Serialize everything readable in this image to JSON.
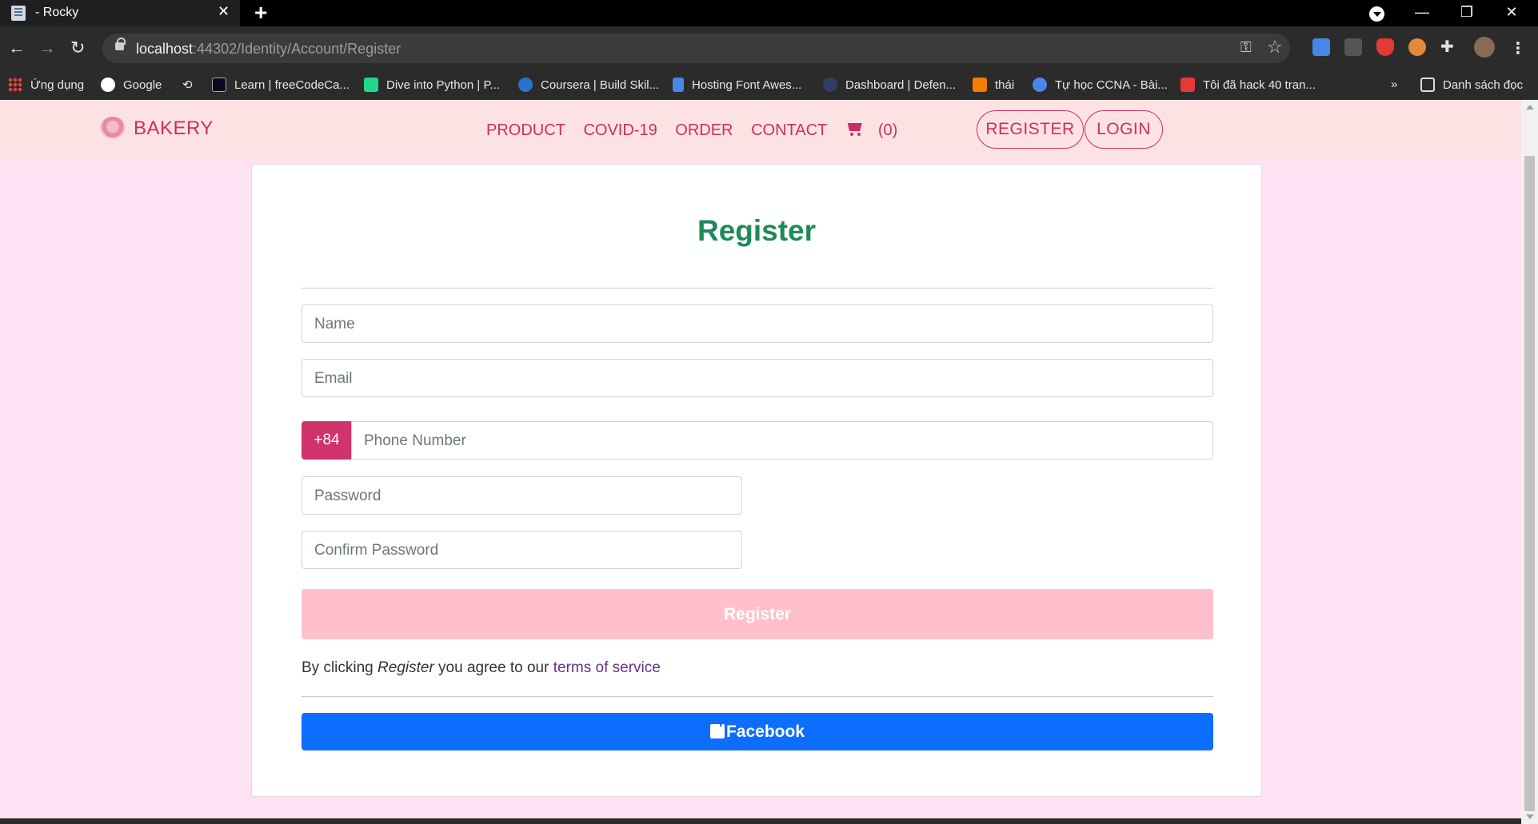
{
  "browser": {
    "tab_title": "- Rocky",
    "url_host": "localhost",
    "url_path": ":44302/Identity/Account/Register",
    "bookmarks": [
      {
        "label": "Ứng dụng",
        "icon": "apps-grid-icon",
        "color": "#e94235"
      },
      {
        "label": "Google",
        "icon": "google-icon",
        "color": "#ffffff"
      },
      {
        "label": "",
        "icon": "history-icon",
        "color": "#cccccc"
      },
      {
        "label": "Learn | freeCodeCa...",
        "icon": "freecodecamp-icon",
        "color": "#0a0a23"
      },
      {
        "label": "Dive into Python | P...",
        "icon": "pycharm-icon",
        "color": "#21d789"
      },
      {
        "label": "Coursera | Build Skil...",
        "icon": "coursera-icon",
        "color": "#2a73cc"
      },
      {
        "label": "Hosting Font Awes...",
        "icon": "flag-icon",
        "color": "#4a86e8"
      },
      {
        "label": "Dashboard | Defen...",
        "icon": "dashboard-icon",
        "color": "#2f3e63"
      },
      {
        "label": "thái",
        "icon": "blogger-icon",
        "color": "#f57d00"
      },
      {
        "label": "Tự học CCNA - Bài...",
        "icon": "search-globe-icon",
        "color": "#4a86e8"
      },
      {
        "label": "Tôi đã hack 40 tran...",
        "icon": "t-icon",
        "color": "#e53935"
      }
    ],
    "more_bookmarks": "»",
    "reading_list": "Danh sách đọc"
  },
  "site": {
    "brand": "BAKERY",
    "nav": {
      "product": "PRODUCT",
      "covid": "COVID-19",
      "order": "ORDER",
      "contact": "CONTACT",
      "cart_count": "(0)"
    },
    "register_btn": "REGISTER",
    "login_btn": "LOGIN",
    "accent": "#cc2e62",
    "nav_bg": "#fde2e4",
    "page_bg": "#fde2f4"
  },
  "form": {
    "title": "Register",
    "name_placeholder": "Name",
    "email_placeholder": "Email",
    "phone_prefix": "+84",
    "phone_placeholder": "Phone Number",
    "password_placeholder": "Password",
    "confirm_placeholder": "Confirm Password",
    "submit_label": "Register",
    "agree_prefix": "By clicking ",
    "agree_em": "Register",
    "agree_middle": " you agree to our ",
    "agree_link": "terms of service",
    "facebook_label": "Facebook",
    "title_color": "#1e8a5a",
    "submit_color": "#ffc0cb",
    "facebook_color": "#0d6efd"
  }
}
